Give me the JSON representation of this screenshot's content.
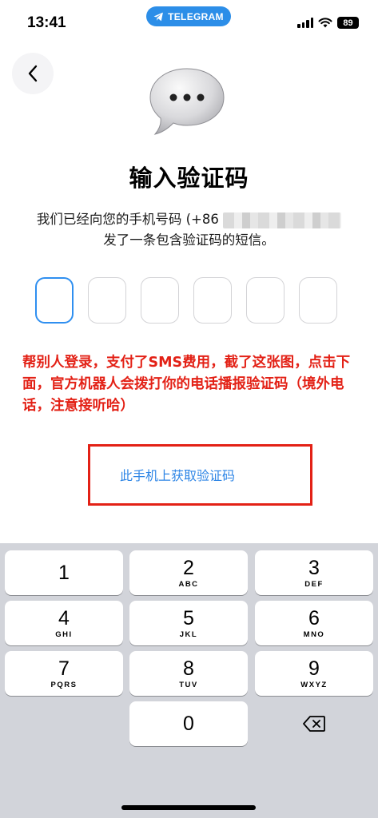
{
  "status": {
    "time": "13:41",
    "app_pill": "TELEGRAM",
    "battery": "89"
  },
  "header": {
    "back_icon": "chevron-left-icon",
    "illustration": "speech-bubble-icon"
  },
  "main": {
    "title": "输入验证码",
    "desc_line1_prefix": "我们已经向您的手机号码 (+86",
    "desc_line2": "发了一条包含验证码的短信。",
    "code_length": 6,
    "annotation": "帮别人登录，支付了SMS费用，截了这张图，点击下面，官方机器人会拨打你的电话播报验证码（境外电话，注意接听哈）",
    "get_code_link": "此手机上获取验证码"
  },
  "keypad": {
    "keys": [
      {
        "num": "1",
        "letters": ""
      },
      {
        "num": "2",
        "letters": "ABC"
      },
      {
        "num": "3",
        "letters": "DEF"
      },
      {
        "num": "4",
        "letters": "GHI"
      },
      {
        "num": "5",
        "letters": "JKL"
      },
      {
        "num": "6",
        "letters": "MNO"
      },
      {
        "num": "7",
        "letters": "PQRS"
      },
      {
        "num": "8",
        "letters": "TUV"
      },
      {
        "num": "9",
        "letters": "WXYZ"
      },
      {
        "num": "0",
        "letters": ""
      }
    ],
    "delete_icon": "backspace-icon"
  },
  "colors": {
    "accent": "#2f8ff0",
    "annotation": "#e32116",
    "keypad_bg": "#d2d4da"
  }
}
